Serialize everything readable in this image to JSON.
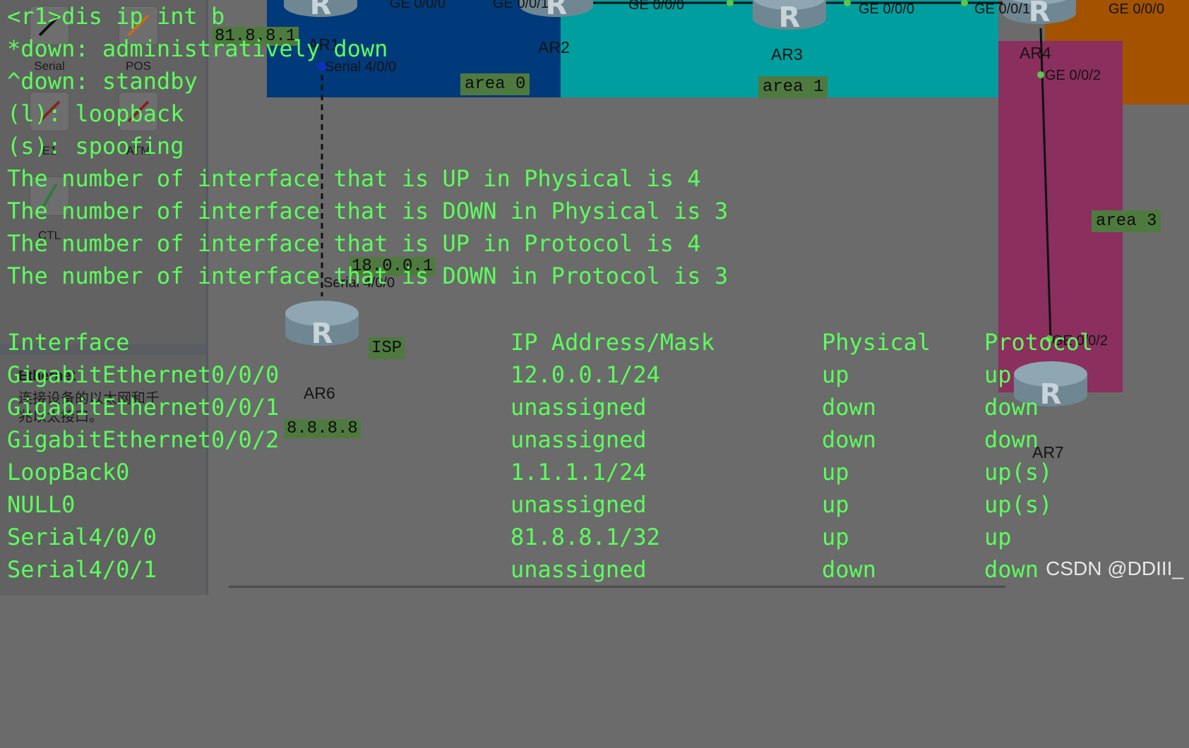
{
  "panel": {
    "devices": [
      {
        "label": "Serial",
        "color": "#111111"
      },
      {
        "label": "POS",
        "color": "#c86a1e"
      },
      {
        "label": "E1",
        "color": "#8a2020"
      },
      {
        "label": "ATM",
        "color": "#8a2020"
      },
      {
        "label": "CTL",
        "color": "#2f7a3f"
      }
    ],
    "selected_title": "Ethernet",
    "selected_desc_line1": "连接设备的以太网和千",
    "selected_desc_line2": "兆以太接口。"
  },
  "topology": {
    "areas": [
      {
        "label": "area 0",
        "color": "#003a7a"
      },
      {
        "label": "area 1",
        "color": "#009e9e"
      },
      {
        "label": "area 3",
        "color": "#8a2f5e"
      },
      {
        "label": "",
        "color": "#a35200"
      }
    ],
    "routers": [
      "AR1",
      "AR2",
      "AR3",
      "AR4",
      "AR6",
      "AR7"
    ],
    "isp_label": "ISP",
    "ip_labels": [
      "81.8.8.1",
      "18.0.0.1",
      "8.8.8.8"
    ],
    "interface_labels": {
      "ar1_serial": "Serial 4/0/0",
      "ar6_serial": "Serial 4/0/0",
      "ar2_ge0": "GE 0/0/0",
      "ar2_ge1": "GE 0/0/1",
      "ar3_left": "GE 0/0/0",
      "ar3_right": "GE 0/0/0",
      "ar4_ge1": "GE 0/0/1",
      "ar4_right": "GE 0/0/0",
      "ar4_ge2": "GE 0/0/2",
      "ar7_ge2": "GE 0/0/2"
    }
  },
  "terminal": {
    "prompt": "<r1>dis ip int b",
    "legend": [
      "*down: administratively down",
      "^down: standby",
      "(l): loopback",
      "(s): spoofing"
    ],
    "summary": [
      "The number of interface that is UP in Physical is 4",
      "The number of interface that is DOWN in Physical is 3",
      "The number of interface that is UP in Protocol is 4",
      "The number of interface that is DOWN in Protocol is 3"
    ],
    "headers": [
      "Interface",
      "IP Address/Mask",
      "Physical",
      "Protocol"
    ],
    "rows": [
      [
        "GigabitEthernet0/0/0",
        "12.0.0.1/24",
        "up",
        "up"
      ],
      [
        "GigabitEthernet0/0/1",
        "unassigned",
        "down",
        "down"
      ],
      [
        "GigabitEthernet0/0/2",
        "unassigned",
        "down",
        "down"
      ],
      [
        "LoopBack0",
        "1.1.1.1/24",
        "up",
        "up(s)"
      ],
      [
        "NULL0",
        "unassigned",
        "up",
        "up(s)"
      ],
      [
        "Serial4/0/0",
        "81.8.8.1/32",
        "up",
        "up"
      ],
      [
        "Serial4/0/1",
        "unassigned",
        "down",
        "down"
      ]
    ],
    "text_color": "#5cff5c"
  },
  "watermark": "CSDN @DDIII_"
}
